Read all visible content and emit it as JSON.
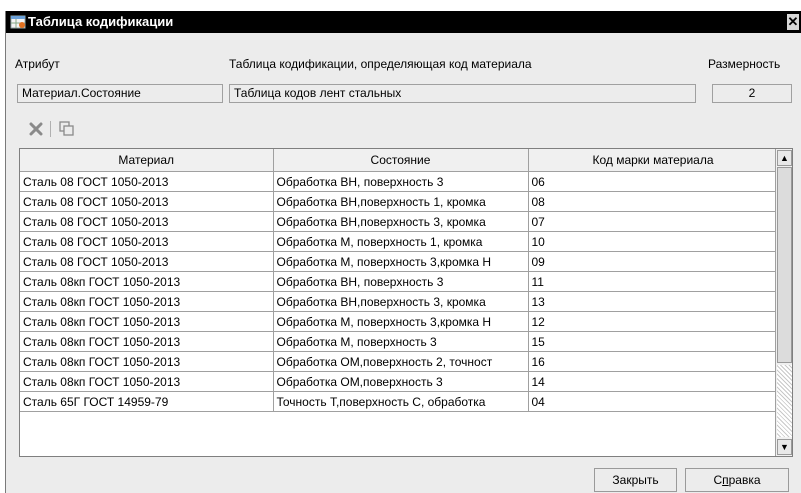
{
  "window": {
    "title": "Таблица кодификации",
    "close_symbol": "✕"
  },
  "form": {
    "attribute_label": "Атрибут",
    "table_label": "Таблица кодификации, определяющая код материала",
    "dimension_label": "Размерность",
    "attribute_value": "Материал.Состояние",
    "table_value": "Таблица кодов лент стальных",
    "dimension_value": "2"
  },
  "toolbar": {
    "delete_icon": "delete-x-icon",
    "copy_icon": "copy-icon"
  },
  "grid": {
    "columns": [
      "Материал",
      "Состояние",
      "Код марки материала"
    ],
    "rows": [
      [
        "Сталь 08 ГОСТ 1050-2013",
        "Обработка ВН, поверхность 3",
        "06"
      ],
      [
        "Сталь 08 ГОСТ 1050-2013",
        "Обработка ВН,поверхность 1, кромка",
        "08"
      ],
      [
        "Сталь 08 ГОСТ 1050-2013",
        "Обработка ВН,поверхность 3, кромка",
        "07"
      ],
      [
        "Сталь 08 ГОСТ 1050-2013",
        "Обработка М, поверхность 1, кромка",
        "10"
      ],
      [
        "Сталь 08 ГОСТ 1050-2013",
        "Обработка М, поверхность 3,кромка Н",
        "09"
      ],
      [
        "Сталь 08кп ГОСТ 1050-2013",
        "Обработка ВН, поверхность 3",
        "11"
      ],
      [
        "Сталь 08кп ГОСТ 1050-2013",
        "Обработка ВН,поверхность 3, кромка",
        "13"
      ],
      [
        "Сталь 08кп ГОСТ 1050-2013",
        "Обработка М, поверхность 3,кромка Н",
        "12"
      ],
      [
        "Сталь 08кп ГОСТ 1050-2013",
        "Обработка М, поверхность 3",
        "15"
      ],
      [
        "Сталь 08кп ГОСТ 1050-2013",
        "Обработка ОМ,поверхность 2, точност",
        "16"
      ],
      [
        "Сталь 08кп ГОСТ 1050-2013",
        "Обработка ОМ,поверхность 3",
        "14"
      ],
      [
        "Сталь 65Г ГОСТ 14959-79",
        "Точность Т,поверхность С, обработка",
        "04"
      ]
    ],
    "scroll_up": "▲",
    "scroll_down": "▼"
  },
  "buttons": {
    "close": "Закрыть",
    "help_pre": "С",
    "help_ul": "п",
    "help_post": "равка"
  },
  "colors": {
    "titlebar": "#000000",
    "window_bg": "#ececec"
  }
}
